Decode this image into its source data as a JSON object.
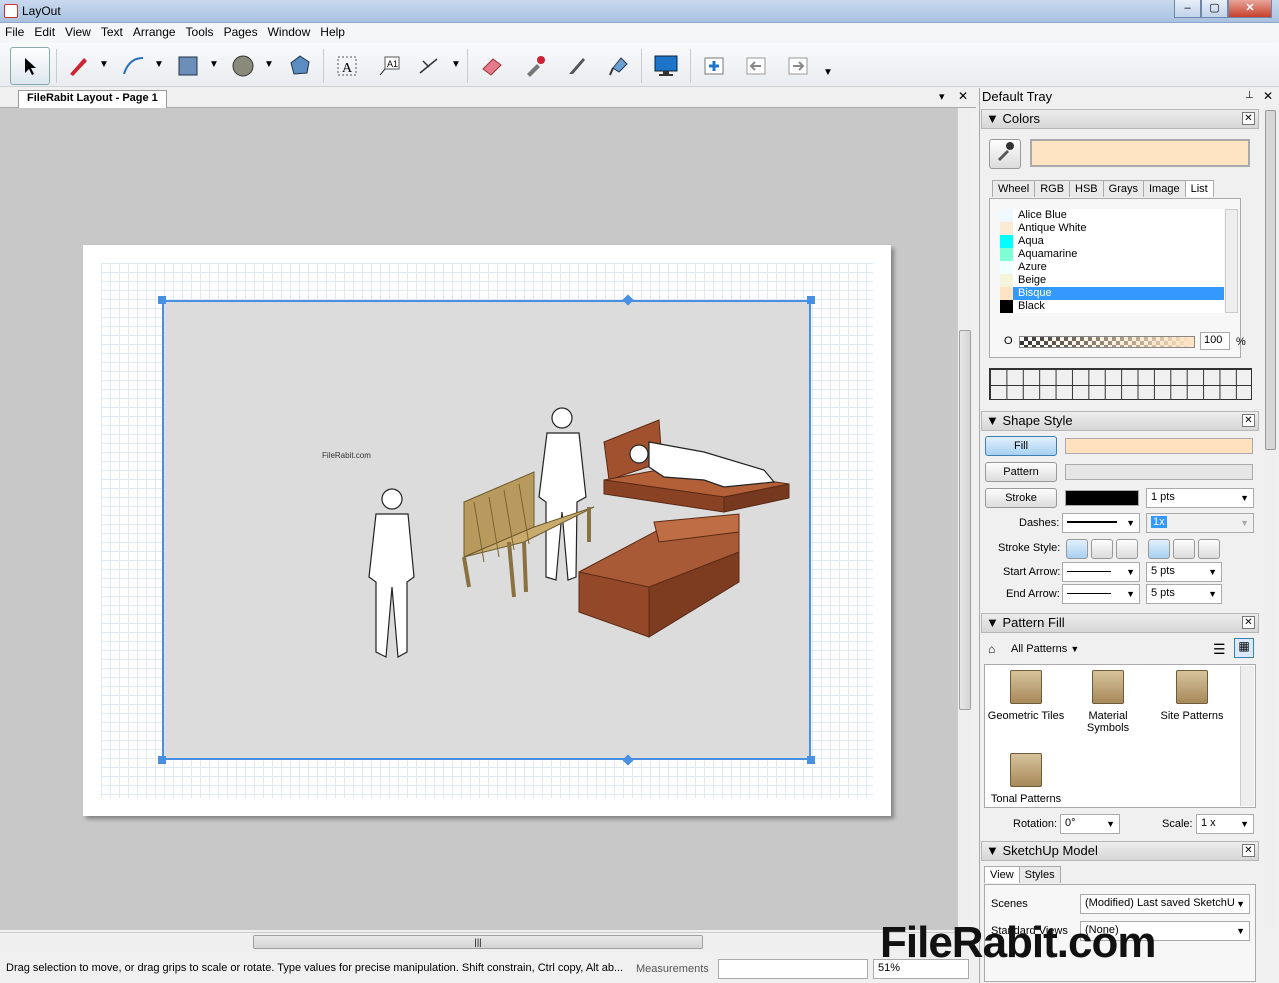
{
  "window": {
    "title": "LayOut",
    "minimize": "‒",
    "maximize": "▢",
    "close": "✕"
  },
  "menu": [
    "File",
    "Edit",
    "View",
    "Text",
    "Arrange",
    "Tools",
    "Pages",
    "Window",
    "Help"
  ],
  "toolbar": {
    "tools": [
      "select",
      "pencil",
      "arc",
      "rectangle",
      "circle",
      "polygon",
      "text",
      "label",
      "dimension",
      "eraser",
      "style-sampler",
      "split",
      "join",
      "presentation",
      "add-page",
      "previous-page",
      "next-page"
    ]
  },
  "document": {
    "tab": "FileRabit Layout - Page 1",
    "pane_menu": "▾",
    "pane_close": "✕"
  },
  "canvas": {
    "watermark_text": "FileRabit.com"
  },
  "status": {
    "message": "Drag selection to move, or drag grips to scale or rotate. Type values for precise manipulation. Shift constrain, Ctrl copy, Alt ab...",
    "measurements_label": "Measurements",
    "measurements_value": "",
    "zoom": "51%"
  },
  "tray": {
    "title": "Default Tray",
    "colors": {
      "title": "Colors",
      "current_color": "#ffe4c4",
      "tabs": [
        "Wheel",
        "RGB",
        "HSB",
        "Grays",
        "Image",
        "List"
      ],
      "active_tab": "List",
      "list": [
        {
          "name": "Alice Blue",
          "color": "#f0f8ff"
        },
        {
          "name": "Antique White",
          "color": "#faebd7"
        },
        {
          "name": "Aqua",
          "color": "#00ffff"
        },
        {
          "name": "Aquamarine",
          "color": "#7fffd4"
        },
        {
          "name": "Azure",
          "color": "#f0ffff"
        },
        {
          "name": "Beige",
          "color": "#f5f5dc"
        },
        {
          "name": "Bisque",
          "color": "#ffe4c4"
        },
        {
          "name": "Black",
          "color": "#000000"
        }
      ],
      "selected": "Bisque",
      "opacity_label": "O",
      "opacity": "100",
      "opacity_unit": "%"
    },
    "shape_style": {
      "title": "Shape Style",
      "fill_label": "Fill",
      "pattern_label": "Pattern",
      "stroke_label": "Stroke",
      "stroke_width": "1 pts",
      "dashes_label": "Dashes:",
      "dash_scale": "1x",
      "stroke_style_label": "Stroke Style:",
      "start_arrow_label": "Start Arrow:",
      "start_arrow_size": "5 pts",
      "end_arrow_label": "End Arrow:",
      "end_arrow_size": "5 pts",
      "fill_color": "#ffe0bf",
      "stroke_color": "#000000"
    },
    "pattern_fill": {
      "title": "Pattern Fill",
      "collection": "All Patterns",
      "items": [
        "Geometric Tiles",
        "Material Symbols",
        "Site Patterns",
        "Tonal Patterns"
      ],
      "rotation_label": "Rotation:",
      "rotation": "0°",
      "scale_label": "Scale:",
      "scale": "1 x"
    },
    "sketchup_model": {
      "title": "SketchUp Model",
      "tabs": [
        "View",
        "Styles"
      ],
      "active_tab": "View",
      "scenes_label": "Scenes",
      "scenes_value": "(Modified) Last saved SketchU",
      "standard_views_label": "Standard Views",
      "standard_views_value": "(None)"
    }
  },
  "watermark": "FileRabit.com"
}
